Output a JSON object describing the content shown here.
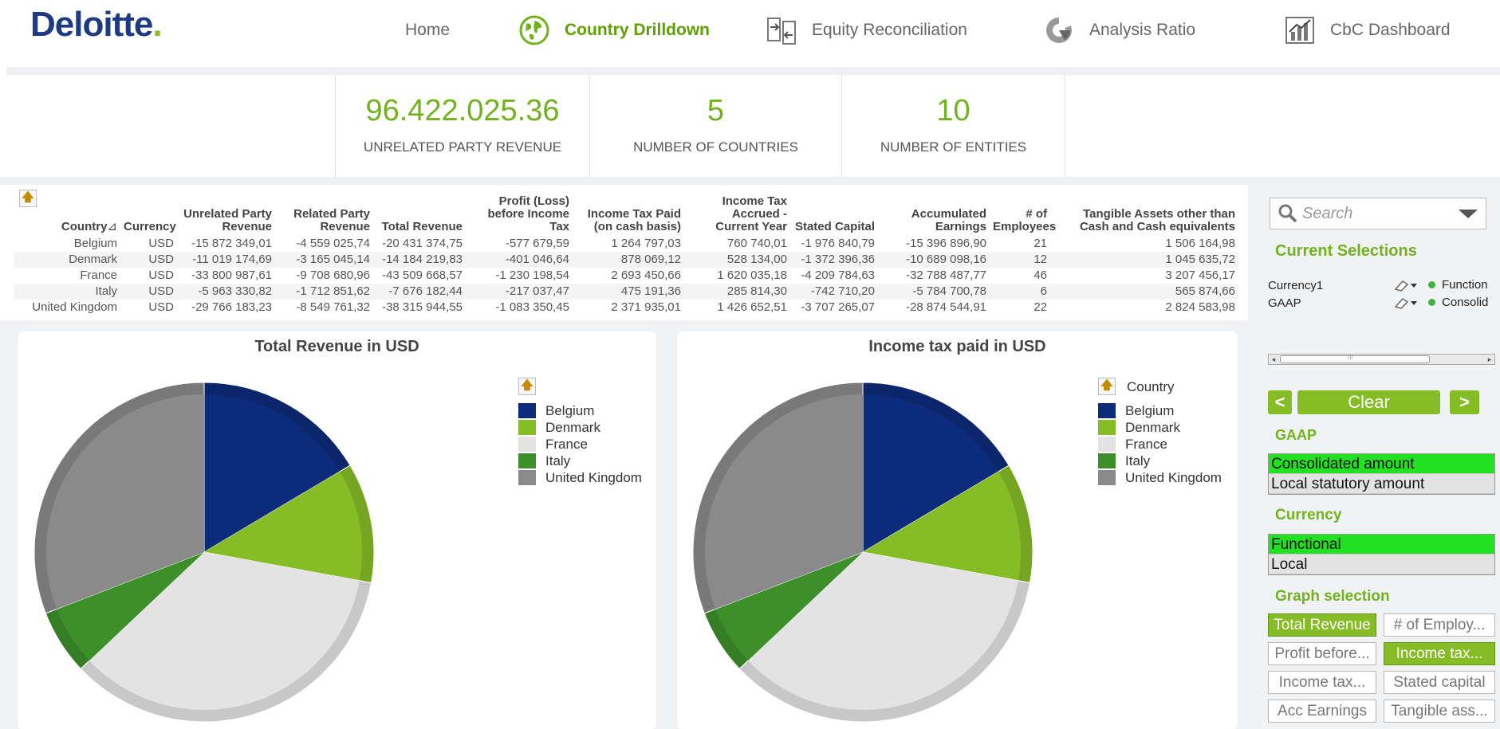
{
  "logo": {
    "text": "Deloitte",
    "dot": "."
  },
  "nav": {
    "home": "Home",
    "country_drilldown": "Country Drilldown",
    "equity_reconciliation": "Equity Reconciliation",
    "analysis_ratio": "Analysis Ratio",
    "cbc_dashboard": "CbC Dashboard"
  },
  "kpis": [
    {
      "value": "96.422.025.36",
      "label": "UNRELATED PARTY REVENUE"
    },
    {
      "value": "5",
      "label": "NUMBER OF COUNTRIES"
    },
    {
      "value": "10",
      "label": "NUMBER OF ENTITIES"
    }
  ],
  "table": {
    "headers": [
      "Country",
      "Currency",
      "Unrelated Party Revenue",
      "Related Party Revenue",
      "Total Revenue",
      "Profit (Loss) before Income Tax",
      "Income Tax Paid (on cash basis)",
      "Income Tax Accrued - Current Year",
      "Stated Capital",
      "Accumulated Earnings",
      "# of Employees",
      "Tangible Assets other than Cash and Cash equivalents"
    ],
    "sort_glyph": "⊿",
    "rows": [
      [
        "Belgium",
        "USD",
        "-15 872 349,01",
        "-4 559 025,74",
        "-20 431 374,75",
        "-577 679,59",
        "1 264 797,03",
        "760 740,01",
        "-1 976 840,79",
        "-15 396 896,90",
        "21",
        "1 506 164,98"
      ],
      [
        "Denmark",
        "USD",
        "-11 019 174,69",
        "-3 165 045,14",
        "-14 184 219,83",
        "-401 046,64",
        "878 069,12",
        "528 134,00",
        "-1 372 396,36",
        "-10 689 098,16",
        "12",
        "1 045 635,72"
      ],
      [
        "France",
        "USD",
        "-33 800 987,61",
        "-9 708 680,96",
        "-43 509 668,57",
        "-1 230 198,54",
        "2 693 450,66",
        "1 620 035,18",
        "-4 209 784,63",
        "-32 788 487,77",
        "46",
        "3 207 456,17"
      ],
      [
        "Italy",
        "USD",
        "-5 963 330,82",
        "-1 712 851,62",
        "-7 676 182,44",
        "-217 037,47",
        "475 191,36",
        "285 814,30",
        "-742 710,20",
        "-5 784 700,78",
        "6",
        "565 874,66"
      ],
      [
        "United Kingdom",
        "USD",
        "-29 766 183,23",
        "-8 549 761,32",
        "-38 315 944,55",
        "-1 083 350,45",
        "2 371 935,01",
        "1 426 652,51",
        "-3 707 265,07",
        "-28 874 544,91",
        "22",
        "2 824 583,98"
      ]
    ]
  },
  "charts": {
    "total_revenue": {
      "title": "Total Revenue in USD"
    },
    "income_tax": {
      "title": "Income tax paid in USD",
      "legend_title": "Country"
    }
  },
  "chart_data": [
    {
      "type": "pie",
      "title": "Total Revenue in USD",
      "categories": [
        "Belgium",
        "Denmark",
        "France",
        "Italy",
        "United Kingdom"
      ],
      "values": [
        20431374.75,
        14184219.83,
        43509668.57,
        7676182.44,
        38315944.55
      ],
      "colors": [
        "#0c2b7a",
        "#86bc25",
        "#e3e3e3",
        "#3d8f2a",
        "#8a8a8a"
      ],
      "legend": "right"
    },
    {
      "type": "pie",
      "title": "Income tax paid in USD",
      "categories": [
        "Belgium",
        "Denmark",
        "France",
        "Italy",
        "United Kingdom"
      ],
      "values": [
        1264797.03,
        878069.12,
        2693450.66,
        475191.36,
        2371935.01
      ],
      "colors": [
        "#0c2b7a",
        "#86bc25",
        "#e3e3e3",
        "#3d8f2a",
        "#8a8a8a"
      ],
      "legend_title": "Country",
      "legend": "right"
    }
  ],
  "sidebar": {
    "search_placeholder": "Search",
    "current_selections_title": "Current Selections",
    "current_selections": [
      {
        "field": "Currency1",
        "value": "Function"
      },
      {
        "field": "GAAP",
        "value": "Consolid"
      }
    ],
    "scroll_mark": "III",
    "prev_label": "<",
    "clear_label": "Clear",
    "next_label": ">",
    "gaap_title": "GAAP",
    "gaap_items": [
      {
        "label": "Consolidated amount",
        "selected": true
      },
      {
        "label": "Local statutory amount",
        "selected": false
      }
    ],
    "currency_title": "Currency",
    "currency_items": [
      {
        "label": "Functional",
        "selected": true
      },
      {
        "label": "Local",
        "selected": false
      }
    ],
    "graph_title": "Graph selection",
    "graph_buttons": [
      {
        "label": "Total Revenue",
        "active": true
      },
      {
        "label": "# of Employ...",
        "active": false
      },
      {
        "label": "Profit before...",
        "active": false
      },
      {
        "label": "Income tax...",
        "active": true
      },
      {
        "label": "Income tax...",
        "active": false
      },
      {
        "label": "Stated capital",
        "active": false
      },
      {
        "label": "Acc Earnings",
        "active": false
      },
      {
        "label": "Tangible ass...",
        "active": false
      }
    ]
  },
  "colors": {
    "brand_blue": "#1d3b85",
    "brand_green": "#86bc25",
    "kpi_green": "#72b21e",
    "selected_green": "#22e122"
  }
}
